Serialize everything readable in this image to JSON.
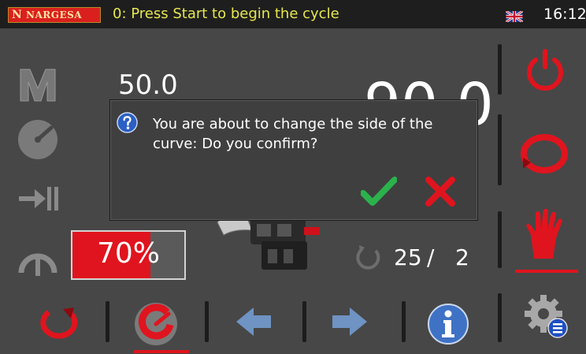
{
  "header": {
    "logo_text": "NARGESA",
    "status_message": "0: Press Start to begin the cycle",
    "language_flag": "uk-flag-icon",
    "clock": "16:12"
  },
  "main": {
    "value_small": "50.0",
    "value_large": "90.0",
    "speed_percent_label": "70%",
    "speed_percent": 70,
    "counter_done": "25",
    "counter_separator": "/",
    "counter_total": "2"
  },
  "left_toolbar": {
    "icons": [
      "manual-mode-icon",
      "gauge-icon",
      "feed-icon",
      "pressure-icon"
    ]
  },
  "right_toolbar": {
    "icons": [
      "power-icon",
      "rotation-cycle-icon",
      "stop-hand-icon",
      "settings-gear-icon"
    ]
  },
  "bottom_toolbar": {
    "icons": [
      "reverse-rotation-icon",
      "curve-side-icon",
      "arrow-left-icon",
      "arrow-right-icon",
      "info-icon"
    ]
  },
  "dialog": {
    "message": "You are about to change the side of the curve: Do you confirm?",
    "confirm_icon": "checkmark-icon",
    "cancel_icon": "cross-icon"
  },
  "colors": {
    "accent_red": "#e0141e",
    "status_yellow": "#e6e651",
    "confirm_green": "#2bb24c",
    "panel_gray": "#474747"
  }
}
